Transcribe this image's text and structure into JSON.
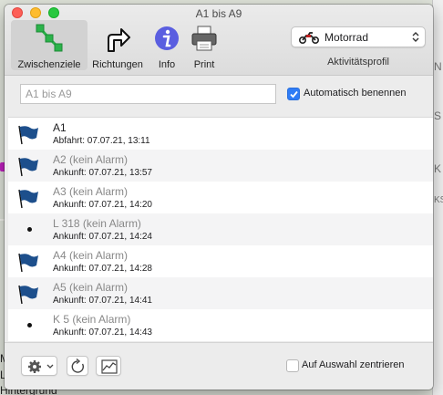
{
  "window": {
    "title": "A1 bis A9"
  },
  "toolbar": {
    "items": [
      {
        "label": "Zwischenziele",
        "icon": "waypoints-icon",
        "active": true
      },
      {
        "label": "Richtungen",
        "icon": "turn-arrow-icon"
      },
      {
        "label": "Info",
        "icon": "info-icon"
      },
      {
        "label": "Print",
        "icon": "printer-icon"
      }
    ],
    "profile": {
      "value": "Motorrad",
      "label": "Aktivitätsprofil",
      "icon": "motorcycle-icon"
    }
  },
  "route": {
    "name_value": "A1 bis A9",
    "auto_name_label": "Automatisch benennen",
    "auto_name_checked": true
  },
  "waypoints": [
    {
      "name": "A1",
      "time": "Abfahrt: 07.07.21, 13:11",
      "marker": "flag"
    },
    {
      "name": "A2 (kein Alarm)",
      "time": "Ankunft: 07.07.21, 13:57",
      "marker": "flag"
    },
    {
      "name": "A3 (kein Alarm)",
      "time": "Ankunft: 07.07.21, 14:20",
      "marker": "flag"
    },
    {
      "name": "L 318 (kein Alarm)",
      "time": "Ankunft: 07.07.21, 14:24",
      "marker": "dot"
    },
    {
      "name": "A4 (kein Alarm)",
      "time": "Ankunft: 07.07.21, 14:28",
      "marker": "flag"
    },
    {
      "name": "A5 (kein Alarm)",
      "time": "Ankunft: 07.07.21, 14:41",
      "marker": "flag"
    },
    {
      "name": "K 5 (kein Alarm)",
      "time": "Ankunft: 07.07.21, 14:43",
      "marker": "dot"
    }
  ],
  "bottom": {
    "center_label": "Auf Auswahl zentrieren",
    "center_checked": false
  },
  "background": {
    "right_texts": [
      "N",
      "S",
      "K",
      "KS"
    ],
    "bottom_texts": [
      "M",
      "La",
      "Hintergrund"
    ]
  },
  "colors": {
    "accent": "#2f7cf6",
    "flag": "#1d4f8c",
    "waypoint_icon": "#2bb34a",
    "info": "#5a5ee0"
  }
}
